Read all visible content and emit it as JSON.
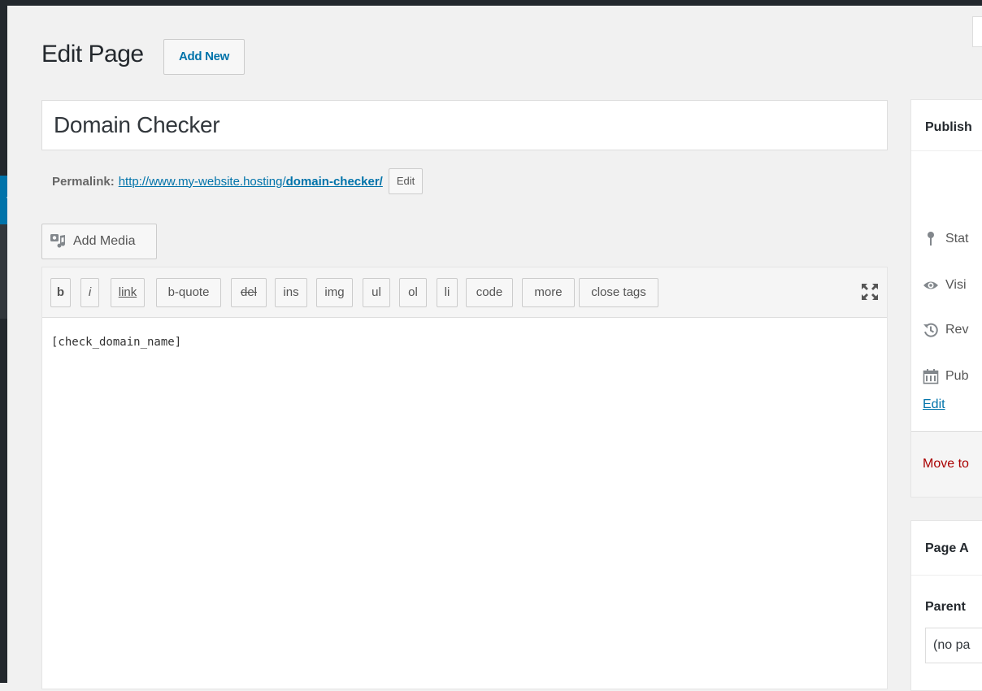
{
  "header": {
    "title": "Edit Page",
    "add_new_label": "Add New"
  },
  "post": {
    "title": "Domain Checker"
  },
  "permalink": {
    "label": "Permalink:",
    "url_base": "http://www.my-website.hosting/",
    "url_slug": "domain-checker/",
    "edit_label": "Edit"
  },
  "media": {
    "add_media_label": "Add Media"
  },
  "quicktags": [
    "b",
    "i",
    "link",
    "b-quote",
    "del",
    "ins",
    "img",
    "ul",
    "ol",
    "li",
    "code",
    "more",
    "close tags"
  ],
  "editor": {
    "content": "[check_domain_name]"
  },
  "publish_box": {
    "title": "Publish",
    "status_label": "Stat",
    "visibility_label": "Visi",
    "revisions_label": "Rev",
    "published_label": "Pub",
    "edit_link": "Edit",
    "trash_label": "Move to"
  },
  "attributes_box": {
    "title": "Page A",
    "parent_label": "Parent",
    "parent_value": "(no pa"
  },
  "colors": {
    "admin_bar": "#23282d",
    "link": "#0073aa",
    "trash": "#aa0000",
    "background": "#f1f1f1"
  }
}
